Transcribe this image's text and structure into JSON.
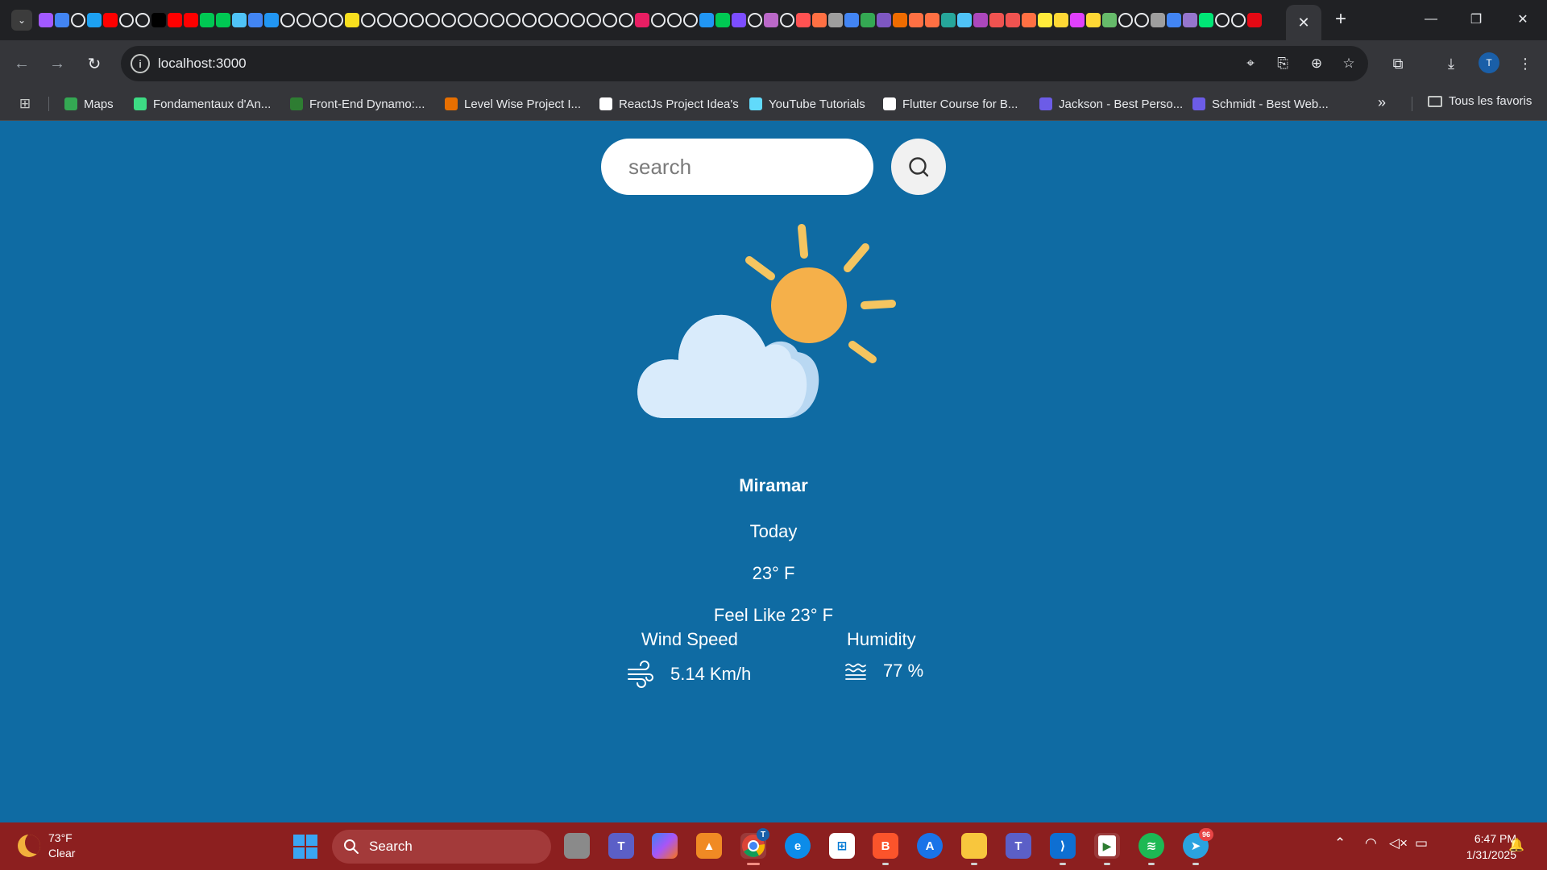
{
  "browser": {
    "address_url": "localhost:3000",
    "close_tab_glyph": "✕",
    "new_tab_glyph": "+",
    "profile_initial": "T",
    "tab_favicon_colors": [
      "#a259ff",
      "#4285f4",
      "#ffffff",
      "#1da1f2",
      "#ff0000",
      "#ffffff",
      "#ffffff",
      "#000000",
      "#ff0000",
      "#ff0000",
      "#00c853",
      "#00c853",
      "#4fc3f7",
      "#4285f4",
      "#2196f3",
      "#ffffff",
      "#ffffff",
      "#ffffff",
      "#ffffff",
      "#f7df1e",
      "#ffffff",
      "#ffffff",
      "#ffffff",
      "#ffffff",
      "#ffffff",
      "#ffffff",
      "#ffffff",
      "#ffffff",
      "#ffffff",
      "#ffffff",
      "#ffffff",
      "#ffffff",
      "#ffffff",
      "#ffffff",
      "#ffffff",
      "#ffffff",
      "#ffffff",
      "#e91e63",
      "#ffffff",
      "#ffffff",
      "#ffffff",
      "#2196f3",
      "#00c853",
      "#7c4dff",
      "#ffffff",
      "#ba68c8",
      "#ffffff",
      "#ff5252",
      "#ff7043",
      "#9e9e9e",
      "#4285f4",
      "#34a853",
      "#7e57c2",
      "#ef6c00",
      "#ff7043",
      "#ff7043",
      "#26a69a",
      "#4fc3f7",
      "#ab47bc",
      "#ef5350",
      "#ef5350",
      "#ff7043",
      "#ffeb3b",
      "#fdd835",
      "#e040fb",
      "#fdd835",
      "#66bb6a",
      "#ffffff",
      "#ffffff",
      "#9e9e9e",
      "#4285f4",
      "#9575cd",
      "#00e676",
      "#ffffff",
      "#ffffff",
      "#e50914"
    ]
  },
  "bookmarks": {
    "items": [
      {
        "label": "Maps",
        "color": "#34a853"
      },
      {
        "label": "Fondamentaux d'An...",
        "color": "#3ddc84"
      },
      {
        "label": "Front-End Dynamo:...",
        "color": "#2e7d32"
      },
      {
        "label": "Level Wise Project I...",
        "color": "#e76f00"
      },
      {
        "label": "ReactJs Project Idea's",
        "color": "#ffffff"
      },
      {
        "label": "YouTube Tutorials",
        "color": "#61dafb"
      },
      {
        "label": "Flutter Course for B...",
        "color": "#ffffff"
      },
      {
        "label": "Jackson - Best Perso...",
        "color": "#6c5ce7"
      },
      {
        "label": "Schmidt - Best Web...",
        "color": "#6c5ce7"
      }
    ],
    "more_glyph": "»",
    "all_bookmarks_label": "Tous les favoris"
  },
  "weather": {
    "search_placeholder": "search",
    "city": "Miramar",
    "day": "Today",
    "temperature": "23° F",
    "feels_like": "Feel Like 23° F",
    "wind_label": "Wind Speed",
    "wind_value": "5.14 Km/h",
    "humidity_label": "Humidity",
    "humidity_value": "77 %",
    "icon": "partly-cloudy-icon",
    "colors": {
      "background": "#0f6ba3",
      "sun": "#f5b04a",
      "cloud": "#d6e9fb"
    }
  },
  "taskbar": {
    "weather_temp": "73°F",
    "weather_condition": "Clear",
    "search_label": "Search",
    "time": "6:47 PM",
    "date": "1/31/2025",
    "chrome_badge": "T",
    "telegram_badge": "96"
  }
}
